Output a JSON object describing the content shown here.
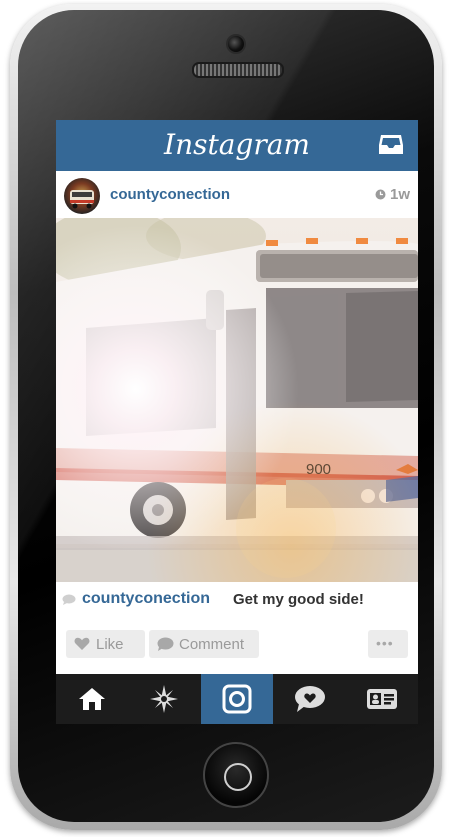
{
  "app": {
    "title": "Instagram"
  },
  "post": {
    "username": "countyconection",
    "time": "1w",
    "caption_username": "countyconection",
    "caption": "Get my good side!",
    "photo": {
      "bus_number": "900"
    }
  },
  "actions": {
    "like_label": "Like",
    "comment_label": "Comment",
    "more_label": "•••"
  },
  "tabbar": {
    "items": [
      "home-icon",
      "explore-icon",
      "camera-icon",
      "activity-icon",
      "profile-icon"
    ],
    "active_index": 2
  },
  "colors": {
    "brand": "#356896",
    "tab_active": "#356896",
    "tab_bg": "#1c1c1c"
  }
}
